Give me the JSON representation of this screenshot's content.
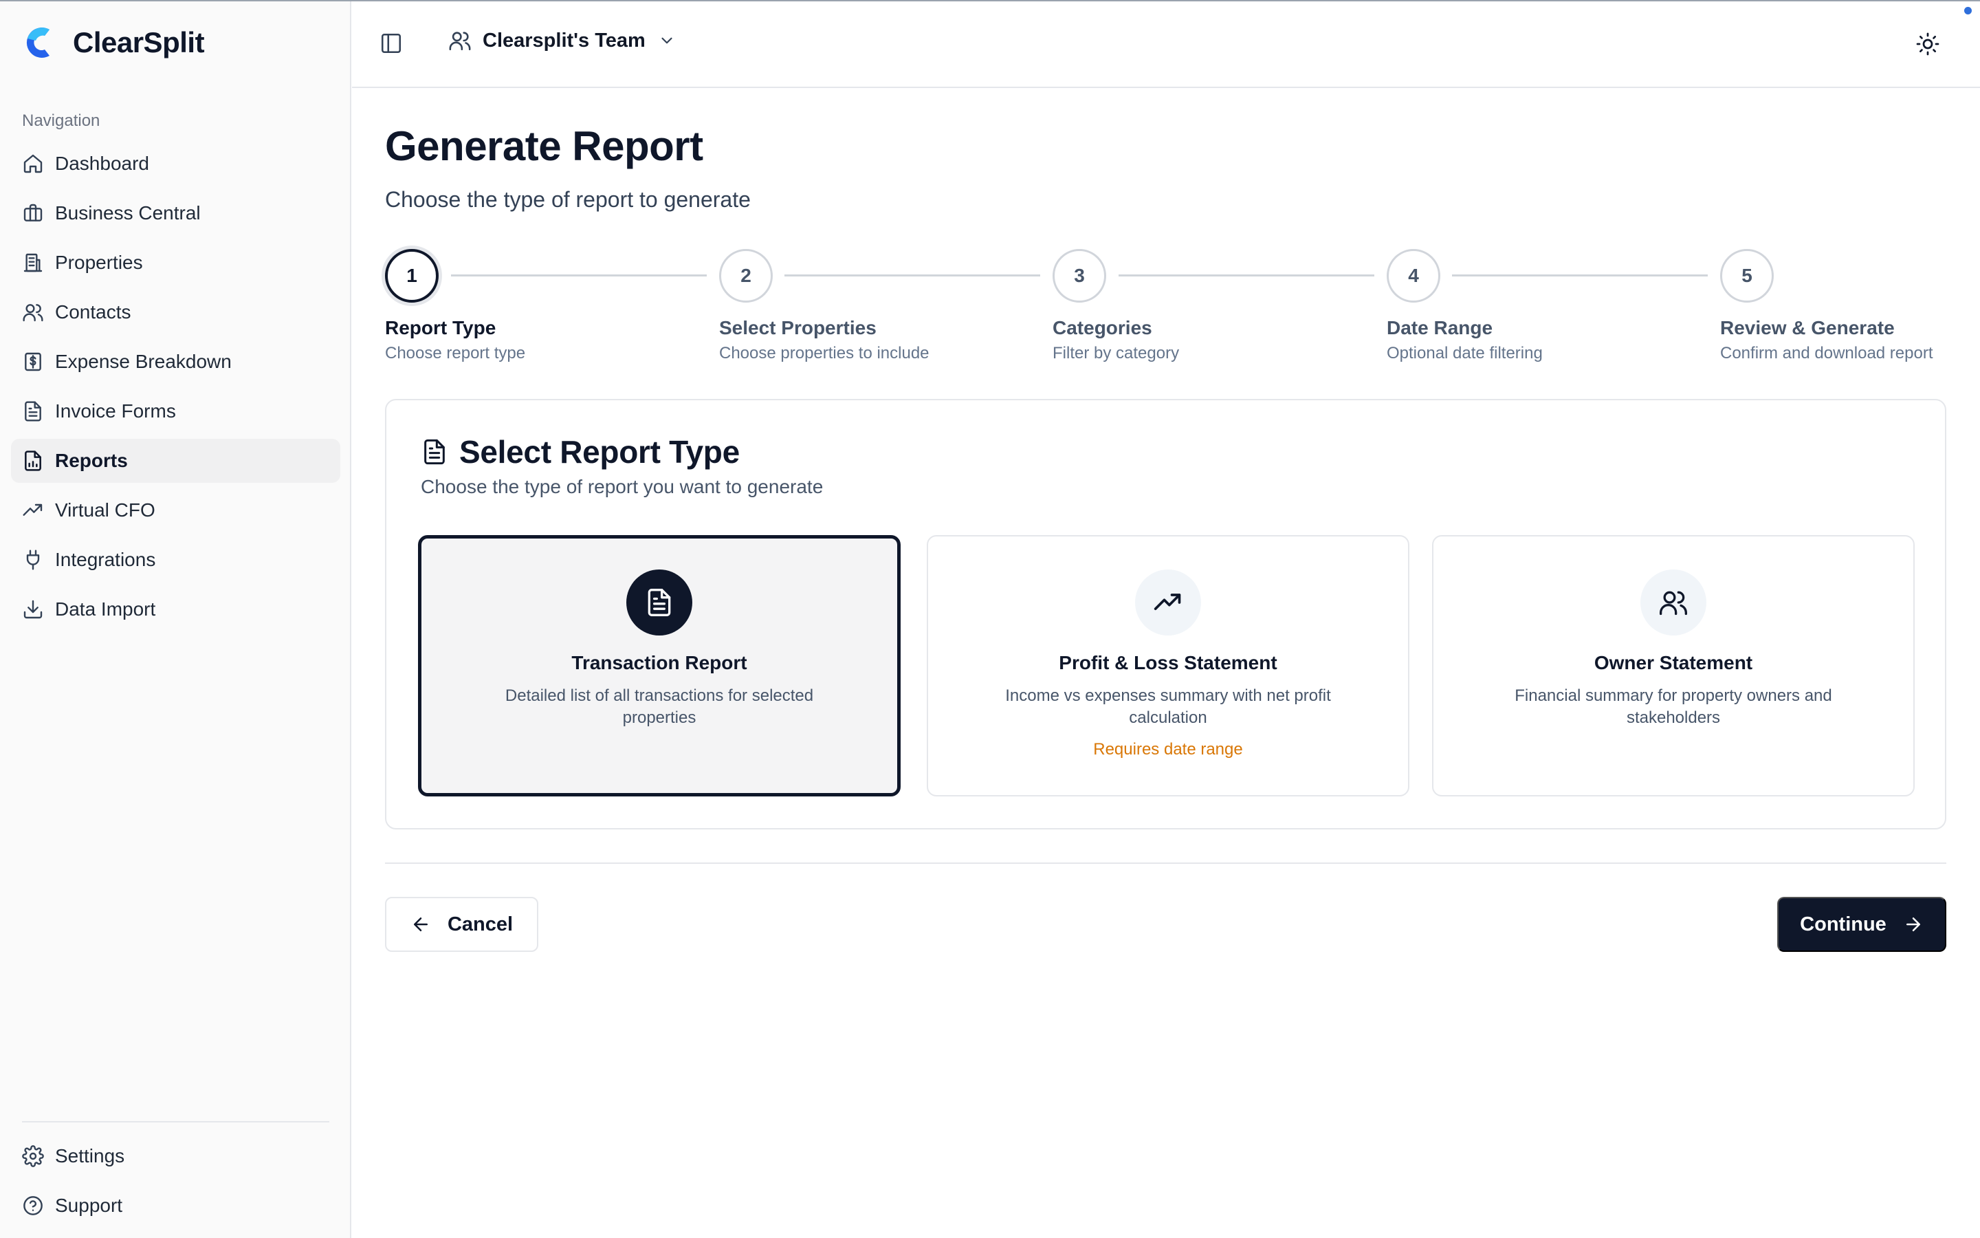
{
  "app": {
    "name": "ClearSplit"
  },
  "sidebar": {
    "nav_label": "Navigation",
    "items": [
      {
        "label": "Dashboard",
        "icon": "home-icon"
      },
      {
        "label": "Business Central",
        "icon": "briefcase-icon"
      },
      {
        "label": "Properties",
        "icon": "building-icon"
      },
      {
        "label": "Contacts",
        "icon": "users-icon"
      },
      {
        "label": "Expense Breakdown",
        "icon": "dollar-receipt-icon"
      },
      {
        "label": "Invoice Forms",
        "icon": "file-text-icon"
      },
      {
        "label": "Reports",
        "icon": "report-icon",
        "active": true
      },
      {
        "label": "Virtual CFO",
        "icon": "trending-up-icon"
      },
      {
        "label": "Integrations",
        "icon": "plug-icon"
      },
      {
        "label": "Data Import",
        "icon": "download-icon"
      }
    ],
    "bottom_items": [
      {
        "label": "Settings",
        "icon": "gear-icon"
      },
      {
        "label": "Support",
        "icon": "help-circle-icon"
      }
    ]
  },
  "header": {
    "team_name": "Clearsplit's Team"
  },
  "page": {
    "title": "Generate Report",
    "subtitle": "Choose the type of report to generate"
  },
  "steps": [
    {
      "number": "1",
      "title": "Report Type",
      "description": "Choose report type",
      "active": true
    },
    {
      "number": "2",
      "title": "Select Properties",
      "description": "Choose properties to include"
    },
    {
      "number": "3",
      "title": "Categories",
      "description": "Filter by category"
    },
    {
      "number": "4",
      "title": "Date Range",
      "description": "Optional date filtering"
    },
    {
      "number": "5",
      "title": "Review & Generate",
      "description": "Confirm and download report"
    }
  ],
  "card": {
    "title": "Select Report Type",
    "subtitle": "Choose the type of report you want to generate",
    "options": [
      {
        "title": "Transaction Report",
        "description": "Detailed list of all transactions for selected properties",
        "icon": "file-text-icon",
        "selected": true
      },
      {
        "title": "Profit & Loss Statement",
        "description": "Income vs expenses summary with net profit calculation",
        "note": "Requires date range",
        "icon": "trending-up-icon"
      },
      {
        "title": "Owner Statement",
        "description": "Financial summary for property owners and stakeholders",
        "icon": "users-icon"
      }
    ]
  },
  "footer": {
    "cancel_label": "Cancel",
    "continue_label": "Continue"
  },
  "colors": {
    "primary": "#0f172a",
    "warning": "#d97706",
    "logo_blue": "#2563eb",
    "logo_cyan": "#38bdf8"
  }
}
